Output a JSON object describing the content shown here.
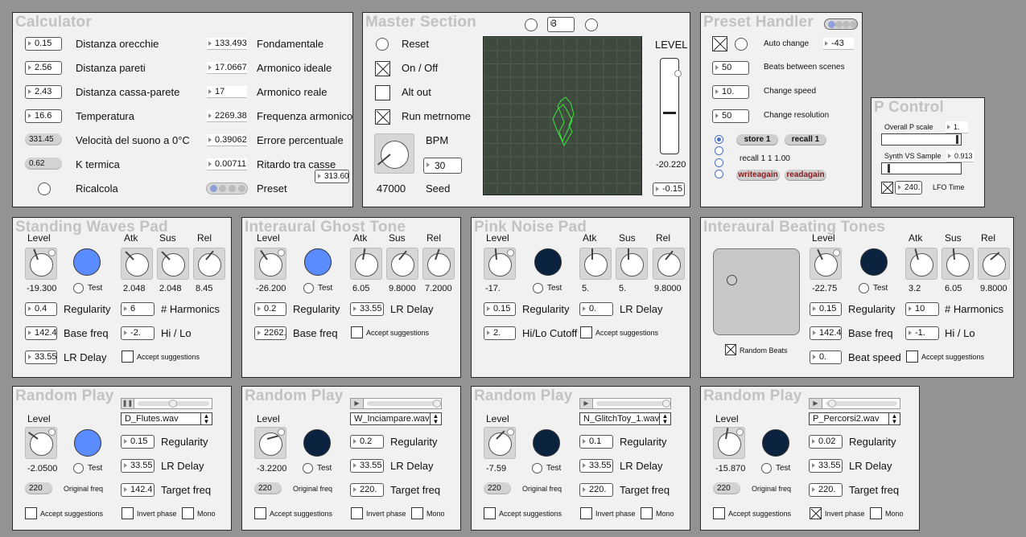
{
  "calculator": {
    "title": "Calculator",
    "left": [
      {
        "value": "0.15",
        "label": "Distanza orecchie"
      },
      {
        "value": "2.56",
        "label": "Distanza pareti"
      },
      {
        "value": "2.43",
        "label": "Distanza cassa-parete"
      },
      {
        "value": "16.6",
        "label": "Temperatura"
      },
      {
        "value": "331.45",
        "label": "Velocità del suono a 0°C"
      },
      {
        "value": "0.62",
        "label": "K termica"
      }
    ],
    "right": [
      {
        "value": "133.493",
        "label": "Fondamentale"
      },
      {
        "value": "17.0667",
        "label": "Armonico ideale"
      },
      {
        "value": "17",
        "label": "Armonico reale"
      },
      {
        "value": "2269.38",
        "label": "Frequenza armonico"
      },
      {
        "value": "0.39062",
        "label": "Errore percentuale"
      },
      {
        "value": "0.00711",
        "label": "Ritardo tra casse"
      }
    ],
    "recalc_label": "Ricalcola",
    "preset_label": "Preset",
    "extra_value": "313.60"
  },
  "master": {
    "title": "Master Section",
    "scene_value": "3",
    "reset_label": "Reset",
    "onoff_label": "On / Off",
    "altout_label": "Alt out",
    "metro_label": "Run metrnome",
    "bpm_label": "BPM",
    "bpm_value": "30",
    "seed_number": "47000",
    "seed_label": "Seed",
    "level_label": "LEVEL",
    "level_value": "-20.220",
    "level_box": "-0.15",
    "level_fill": 0.42,
    "toggles": {
      "onoff": true,
      "altout": false,
      "metro": true
    }
  },
  "preset_handler": {
    "title": "Preset Handler",
    "auto_change_label": "Auto change",
    "auto_change_value": "-43",
    "rows": [
      {
        "value": "50",
        "label": "Beats between scenes"
      },
      {
        "value": "10.",
        "label": "Change speed"
      },
      {
        "value": "50",
        "label": "Change resolution"
      }
    ],
    "store_label": "store 1",
    "recall_label": "recall 1",
    "recall_text": "recall 1 1 1.00",
    "writeagain_label": "writeagain",
    "readagain_label": "readagain"
  },
  "p_control": {
    "title": "P Control",
    "overall_label": "Overall P scale",
    "overall_value": "1.",
    "synth_label": "Synth VS Sample",
    "synth_value": "0.913",
    "lfo_value": "240.",
    "lfo_label": "LFO Time"
  },
  "pads": {
    "standing": {
      "title": "Standing Waves Pad",
      "level_label": "Level",
      "atk_label": "Atk",
      "sus_label": "Sus",
      "rel_label": "Rel",
      "level_value": "-19.300",
      "atk_value": "2.048",
      "sus_value": "2.048",
      "rel_value": "8.45",
      "test_label": "Test",
      "regularity_value": "0.4",
      "regularity_label": "Regularity",
      "harmonics_value": "6",
      "harmonics_label": "# Harmonics",
      "basefreq_value": "142.4",
      "basefreq_label": "Base freq",
      "hilo_value": "-2.",
      "hilo_label": "Hi / Lo",
      "lrdelay_value": "33.55",
      "lrdelay_label": "LR Delay",
      "accept_label": "Accept suggestions"
    },
    "ghost": {
      "title": "Interaural Ghost Tone",
      "level_label": "Level",
      "atk_label": "Atk",
      "sus_label": "Sus",
      "rel_label": "Rel",
      "level_value": "-26.200",
      "atk_value": "6.05",
      "sus_value": "9.8000",
      "rel_value": "7.2000",
      "test_label": "Test",
      "regularity_value": "0.2",
      "regularity_label": "Regularity",
      "lrdelay_value": "33.55",
      "lrdelay_label": "LR Delay",
      "basefreq_value": "2262.",
      "basefreq_label": "Base freq",
      "accept_label": "Accept suggestions"
    },
    "pink": {
      "title": "Pink Noise Pad",
      "level_label": "Level",
      "atk_label": "Atk",
      "sus_label": "Sus",
      "rel_label": "Rel",
      "level_value": "-17.",
      "atk_value": "5.",
      "sus_value": "5.",
      "rel_value": "9.8000",
      "test_label": "Test",
      "regularity_value": "0.15",
      "regularity_label": "Regularity",
      "lrdelay_value": "0.",
      "lrdelay_label": "LR Delay",
      "cutoff_value": "2.",
      "cutoff_label": "Hi/Lo Cutoff",
      "accept_label": "Accept suggestions"
    },
    "beating": {
      "title": "Interaural Beating Tones",
      "level_label": "Level",
      "atk_label": "Atk",
      "sus_label": "Sus",
      "rel_label": "Rel",
      "level_value": "-22.75",
      "atk_value": "3.2",
      "sus_value": "6.05",
      "rel_value": "9.8000",
      "test_label": "Test",
      "regularity_value": "0.15",
      "regularity_label": "Regularity",
      "harmonics_value": "10",
      "harmonics_label": "# Harmonics",
      "basefreq_value": "142.4",
      "basefreq_label": "Base freq",
      "hilo_value": "-1.",
      "hilo_label": "Hi / Lo",
      "beatspeed_value": "0.",
      "beatspeed_label": "Beat speed",
      "random_beats_label": "Random Beats",
      "accept_label": "Accept suggestions"
    }
  },
  "random_play": [
    {
      "title": "Random Play",
      "file": "D_Flutes.wav",
      "level_label": "Level",
      "level_value": "-2.0500",
      "test_label": "Test",
      "regularity_value": "0.15",
      "regularity_label": "Regularity",
      "lrdelay_value": "33.55",
      "lrdelay_label": "LR Delay",
      "origfreq_value": "220",
      "origfreq_label": "Original freq",
      "target_value": "142.4",
      "target_label": "Target freq",
      "accept_label": "Accept suggestions",
      "invert_label": "Invert phase",
      "mono_label": "Mono",
      "led": "#5a8cff",
      "playing": true,
      "invert": false
    },
    {
      "title": "Random Play",
      "file": "W_Inciampare.wav",
      "level_label": "Level",
      "level_value": "-3.2200",
      "test_label": "Test",
      "regularity_value": "0.2",
      "regularity_label": "Regularity",
      "lrdelay_value": "33.55",
      "lrdelay_label": "LR Delay",
      "origfreq_value": "220",
      "origfreq_label": "Original freq",
      "target_value": "220.",
      "target_label": "Target freq",
      "accept_label": "Accept suggestions",
      "invert_label": "Invert phase",
      "mono_label": "Mono",
      "led": "#0c2340",
      "playing": false,
      "invert": false
    },
    {
      "title": "Random Play",
      "file": "N_GlitchToy_1.wav",
      "level_label": "Level",
      "level_value": "-7.59",
      "test_label": "Test",
      "regularity_value": "0.1",
      "regularity_label": "Regularity",
      "lrdelay_value": "33.55",
      "lrdelay_label": "LR Delay",
      "origfreq_value": "220",
      "origfreq_label": "Original freq",
      "target_value": "220.",
      "target_label": "Target freq",
      "accept_label": "Accept suggestions",
      "invert_label": "Invert phase",
      "mono_label": "Mono",
      "led": "#0c2340",
      "playing": false,
      "invert": false
    },
    {
      "title": "Random Play",
      "file": "P_Percorsi2.wav",
      "level_label": "Level",
      "level_value": "-15.870",
      "test_label": "Test",
      "regularity_value": "0.02",
      "regularity_label": "Regularity",
      "lrdelay_value": "33.55",
      "lrdelay_label": "LR Delay",
      "origfreq_value": "220",
      "origfreq_label": "Original freq",
      "target_value": "220.",
      "target_label": "Target freq",
      "accept_label": "Accept suggestions",
      "invert_label": "Invert phase",
      "mono_label": "Mono",
      "led": "#0c2340",
      "playing": false,
      "invert": true
    }
  ],
  "colors": {
    "led_blue": "#5a8cff",
    "led_dark": "#0c2340",
    "lcd_bg": "#3e4a3e",
    "lcd_trace": "#39e639"
  }
}
